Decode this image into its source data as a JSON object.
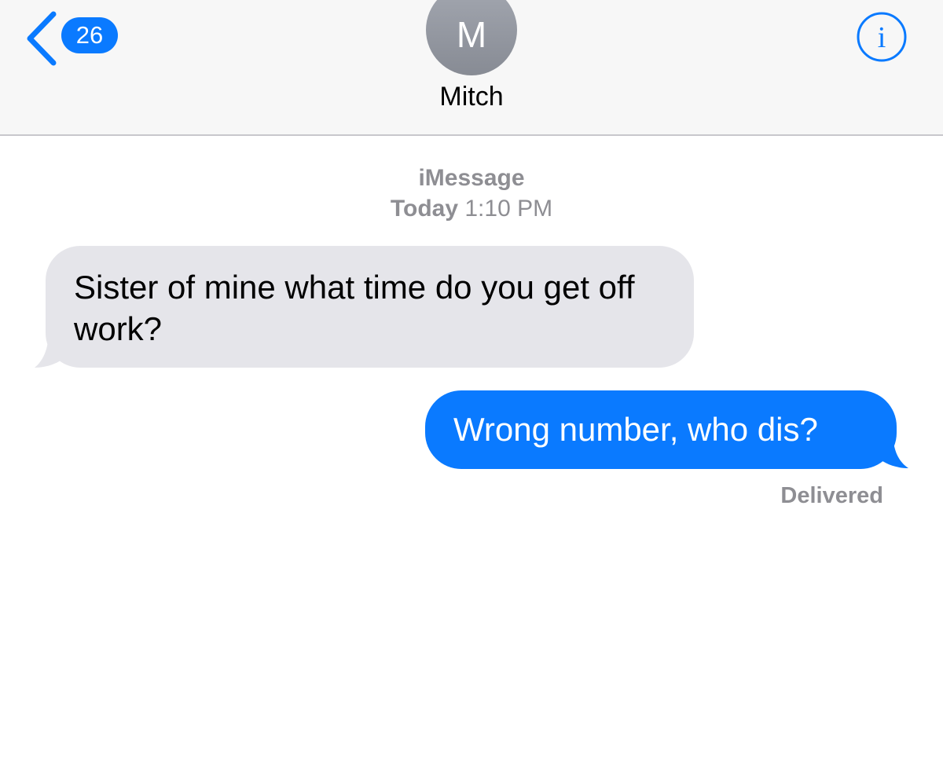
{
  "header": {
    "back_badge_count": "26",
    "avatar_initial": "M",
    "contact_name": "Mitch",
    "icons": {
      "back": "chevron-left-icon",
      "info": "info-icon"
    },
    "accent_color": "#0a7aff"
  },
  "conversation": {
    "service": "iMessage",
    "timestamp_day": "Today",
    "timestamp_time": "1:10 PM",
    "messages": [
      {
        "direction": "incoming",
        "text": "Sister of mine what time do you get off work?",
        "bubble_color": "#e5e5ea"
      },
      {
        "direction": "outgoing",
        "text": "Wrong number, who dis?",
        "bubble_color": "#0a7aff"
      }
    ],
    "status": "Delivered"
  }
}
